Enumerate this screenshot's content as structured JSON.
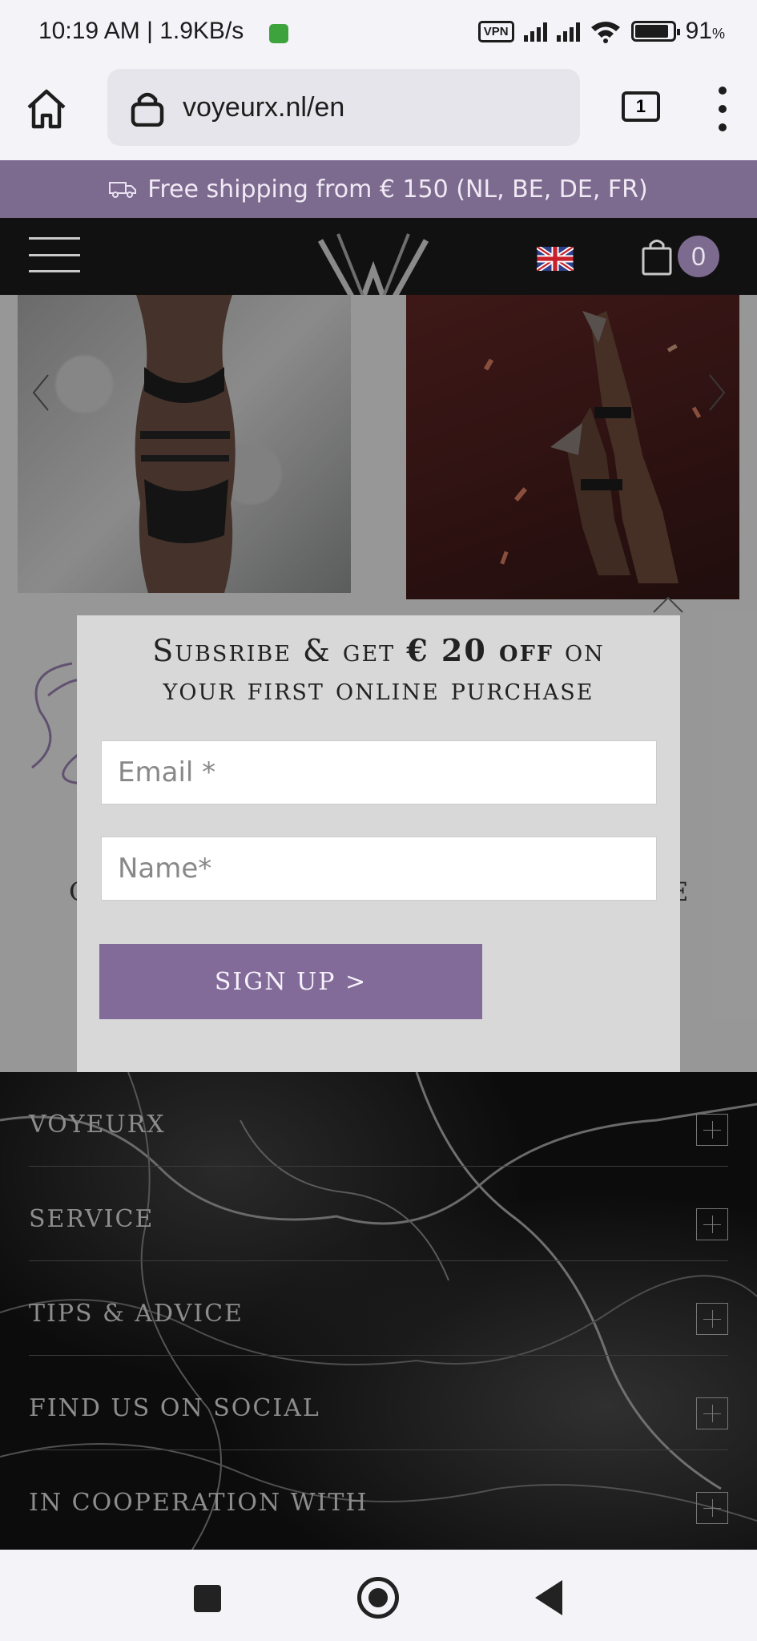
{
  "status_bar": {
    "time": "10:19 AM | 1.9KB/s",
    "vpn": "VPN",
    "battery": "91",
    "battery_unit": "%",
    "battery_level": 0.91
  },
  "browser": {
    "url": "voyeurx.nl/en",
    "tab_count": "1"
  },
  "site": {
    "shipping_banner": "Free shipping from € 150 (NL, BE, DE, FR)",
    "cart_count": "0",
    "page_text_left": "C",
    "page_text_right": "E"
  },
  "modal": {
    "title_line1_a": "Subsribe & get ",
    "title_line1_strong": "€ 20 off",
    "title_line1_b": " on",
    "title_line2": "your first online purchase",
    "email_placeholder": "Email *",
    "name_placeholder": "Name*",
    "signup_label": "SIGN UP >"
  },
  "footer": {
    "items": [
      {
        "label": "VOYEURX"
      },
      {
        "label": "SERVICE"
      },
      {
        "label": "TIPS & ADVICE"
      },
      {
        "label": "FIND US ON SOCIAL"
      },
      {
        "label": "IN COOPERATION WITH"
      }
    ]
  },
  "colors": {
    "brand_purple": "#7d6a8f",
    "button_purple": "#826a99",
    "header_black": "#111111"
  }
}
